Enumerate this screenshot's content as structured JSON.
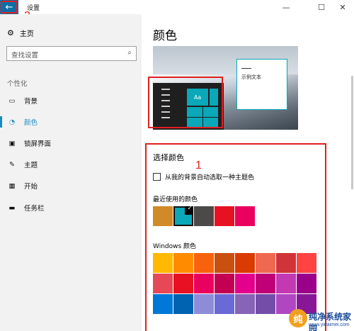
{
  "window": {
    "title": "设置",
    "back_icon": "←",
    "minimize": "—",
    "maximize": "☐",
    "close": "✕"
  },
  "annotations": {
    "marker_back": "2",
    "marker_colors": "1"
  },
  "sidebar": {
    "home_label": "主页",
    "search_placeholder": "查找设置",
    "section_title": "个性化",
    "items": [
      {
        "label": "背景",
        "icon": "image-icon",
        "glyph": "▭"
      },
      {
        "label": "颜色",
        "icon": "palette-icon",
        "glyph": "◔",
        "active": true
      },
      {
        "label": "锁屏界面",
        "icon": "lock-screen-icon",
        "glyph": "▣"
      },
      {
        "label": "主题",
        "icon": "theme-icon",
        "glyph": "✎"
      },
      {
        "label": "开始",
        "icon": "start-icon",
        "glyph": "▦"
      },
      {
        "label": "任务栏",
        "icon": "taskbar-icon",
        "glyph": "▬"
      }
    ]
  },
  "main": {
    "page_title": "颜色",
    "preview": {
      "tile_label": "Aa",
      "sample_text": "示例文本"
    },
    "choose_color": {
      "title": "选择颜色",
      "auto_pick_label": "从我的背景自动选取一种主题色",
      "auto_pick_checked": false,
      "recent_label": "最近使用的颜色",
      "recent_colors": [
        "#d08a27",
        "#0aa8b8",
        "#4c4a48",
        "#e81123",
        "#ea005e"
      ],
      "recent_selected_index": 1,
      "windows_label": "Windows 颜色",
      "windows_colors": [
        "#ffb900",
        "#ff8c00",
        "#f7630c",
        "#ca5010",
        "#da3b01",
        "#ef6950",
        "#d13438",
        "#ff4343",
        "#e74856",
        "#e81123",
        "#ea005e",
        "#c30052",
        "#e3008c",
        "#bf0077",
        "#c239b3",
        "#9a0089",
        "#0078d7",
        "#0063b1",
        "#8e8cd8",
        "#6b69d6",
        "#8764b8",
        "#744da9",
        "#b146c2",
        "#881798"
      ]
    }
  },
  "watermark": {
    "text": "纯净系统家园",
    "url": "www.yidaimei.com"
  }
}
